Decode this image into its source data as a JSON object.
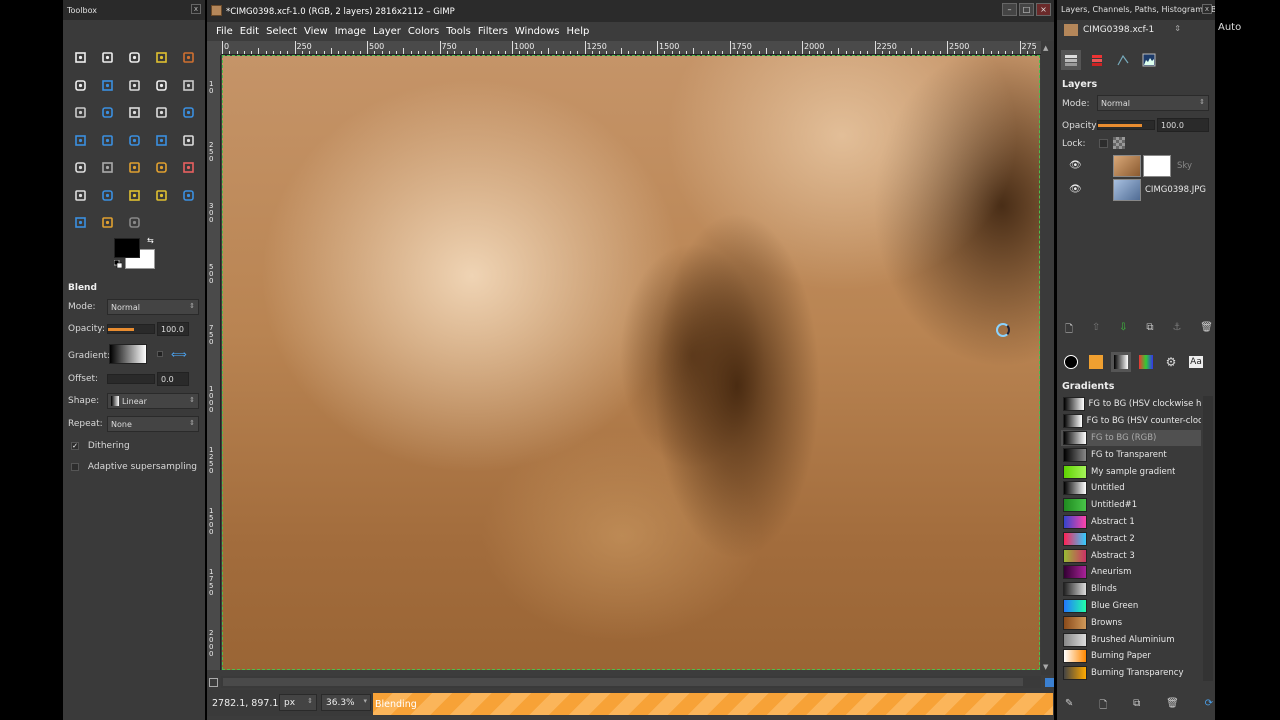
{
  "toolbox": {
    "title": "Toolbox",
    "tools": [
      "rect-select-icon",
      "ellipse-select-icon",
      "free-select-icon",
      "fuzzy-select-icon",
      "select-by-color-icon",
      "scissors-icon",
      "foreground-select-icon",
      "paths-icon",
      "color-picker-icon",
      "zoom-icon",
      "measure-icon",
      "move-icon",
      "align-icon",
      "crop-icon",
      "rotate-icon",
      "scale-icon",
      "shear-icon",
      "perspective-icon",
      "flip-icon",
      "text-icon",
      "bucket-fill-icon",
      "blend-icon",
      "pencil-icon",
      "paintbrush-icon",
      "eraser-icon",
      "airbrush-icon",
      "ink-icon",
      "clone-icon",
      "heal-icon",
      "perspective-clone-icon",
      "blur-icon",
      "smudge-icon",
      "dodge-burn-icon"
    ],
    "colors": {
      "fg": "#000000",
      "bg": "#ffffff"
    }
  },
  "tool_options": {
    "title": "Blend",
    "mode_label": "Mode:",
    "mode_value": "Normal",
    "opacity_label": "Opacity:",
    "opacity_value": "100.0",
    "gradient_label": "Gradient:",
    "offset_label": "Offset:",
    "offset_value": "0.0",
    "shape_label": "Shape:",
    "shape_value": "Linear",
    "repeat_label": "Repeat:",
    "repeat_value": "None",
    "dithering_label": "Dithering",
    "dithering_checked": true,
    "adaptive_label": "Adaptive supersampling",
    "adaptive_checked": false
  },
  "image_window": {
    "title": "*CIMG0398.xcf-1.0 (RGB, 2 layers) 2816x2112 – GIMP",
    "menus": [
      "File",
      "Edit",
      "Select",
      "View",
      "Image",
      "Layer",
      "Colors",
      "Tools",
      "Filters",
      "Windows",
      "Help"
    ],
    "ruler_labels": [
      "0",
      "250",
      "500",
      "750",
      "1000",
      "1250",
      "1500",
      "1750",
      "2000",
      "2250",
      "2500",
      "275"
    ],
    "vruler_labels": [
      "1\n0",
      "2\n5\n0",
      "3\n0\n0",
      "5\n0\n0",
      "7\n5\n0",
      "1\n0\n0\n0",
      "1\n2\n5\n0",
      "1\n5\n0\n0",
      "1\n7\n5\n0",
      "2\n0\n0\n0"
    ],
    "coords": "2782.1, 897.1",
    "unit": "px",
    "zoom": "36.3%",
    "progress_label": "Blending",
    "progress_color": "#f7a237"
  },
  "dock": {
    "title": "Layers, Channels, Paths, Histogram - B...",
    "image_select": "CIMG0398.xcf-1",
    "auto_label": "Auto",
    "layers_title": "Layers",
    "mode_label": "Mode:",
    "mode_value": "Normal",
    "opacity_label": "Opacity:",
    "opacity_value": "100.0",
    "lock_label": "Lock:",
    "layers": [
      {
        "name": "Sky",
        "visible": true,
        "has_mask": true
      },
      {
        "name": "CIMG0398.JPG",
        "visible": true,
        "has_mask": false
      }
    ],
    "gradients_title": "Gradients",
    "gradients": [
      {
        "name": "FG to BG (HSV clockwise hue)",
        "colors": [
          "#000000",
          "#ffffff"
        ]
      },
      {
        "name": "FG to BG (HSV counter-clockwise)",
        "colors": [
          "#000000",
          "#ffffff"
        ]
      },
      {
        "name": "FG to BG (RGB)",
        "colors": [
          "#000000",
          "#ffffff"
        ]
      },
      {
        "name": "FG to Transparent",
        "colors": [
          "#000000",
          "#888888"
        ]
      },
      {
        "name": "My sample gradient",
        "colors": [
          "#5ed400",
          "#a6f45a"
        ]
      },
      {
        "name": "Untitled",
        "colors": [
          "#000000",
          "#ffffff"
        ]
      },
      {
        "name": "Untitled#1",
        "colors": [
          "#1f8a1f",
          "#49c449"
        ]
      },
      {
        "name": "Abstract 1",
        "colors": [
          "#3344cc",
          "#ff44aa"
        ]
      },
      {
        "name": "Abstract 2",
        "colors": [
          "#ff2255",
          "#33ccff"
        ]
      },
      {
        "name": "Abstract 3",
        "colors": [
          "#99bb33",
          "#cc3366"
        ]
      },
      {
        "name": "Aneurism",
        "colors": [
          "#330033",
          "#aa2299"
        ]
      },
      {
        "name": "Blinds",
        "colors": [
          "#222222",
          "#dddddd"
        ]
      },
      {
        "name": "Blue Green",
        "colors": [
          "#2277ff",
          "#22ffaa"
        ]
      },
      {
        "name": "Browns",
        "colors": [
          "#8a4a1a",
          "#d09a5a"
        ]
      },
      {
        "name": "Brushed Aluminium",
        "colors": [
          "#888888",
          "#dddddd"
        ]
      },
      {
        "name": "Burning Paper",
        "colors": [
          "#ffffff",
          "#ff8800"
        ]
      },
      {
        "name": "Burning Transparency",
        "colors": [
          "#444444",
          "#ffaa00"
        ]
      }
    ],
    "selected_gradient": 2
  }
}
